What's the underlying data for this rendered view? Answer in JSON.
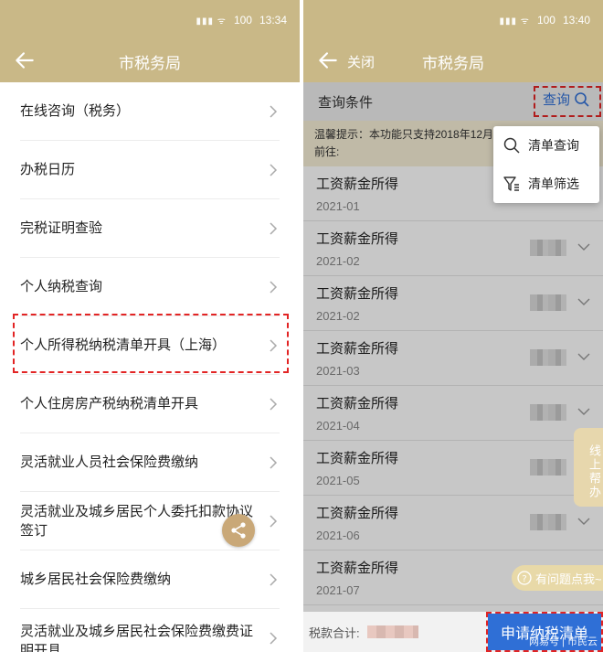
{
  "left": {
    "status": {
      "time": "13:34",
      "battery": "100"
    },
    "header": {
      "title": "市税务局"
    },
    "items": [
      {
        "label": "在线咨询（税务）"
      },
      {
        "label": "办税日历"
      },
      {
        "label": "完税证明查验"
      },
      {
        "label": "个人纳税查询"
      },
      {
        "label": "个人所得税纳税清单开具（上海）"
      },
      {
        "label": "个人住房房产税纳税清单开具"
      },
      {
        "label": "灵活就业人员社会保险费缴纳"
      },
      {
        "label": "灵活就业及城乡居民个人委托扣款协议签订"
      },
      {
        "label": "城乡居民社会保险费缴纳"
      },
      {
        "label": "灵活就业及城乡居民社会保险费缴费证明开具"
      }
    ]
  },
  "right": {
    "status": {
      "time": "13:40",
      "battery": "100"
    },
    "header": {
      "title": "市税务局",
      "close_label": "关闭"
    },
    "query": {
      "title": "查询条件",
      "button": "查询"
    },
    "tip": {
      "line1": "温馨提示：本功能只支持2018年12月",
      "line2": "前往:"
    },
    "dropdown": [
      {
        "label": "清单查询",
        "icon": "search-icon"
      },
      {
        "label": "清单筛选",
        "icon": "filter-icon"
      }
    ],
    "records": [
      {
        "name": "工资薪金所得",
        "date": "2021-01"
      },
      {
        "name": "工资薪金所得",
        "date": "2021-02"
      },
      {
        "name": "工资薪金所得",
        "date": "2021-02"
      },
      {
        "name": "工资薪金所得",
        "date": "2021-03"
      },
      {
        "name": "工资薪金所得",
        "date": "2021-04"
      },
      {
        "name": "工资薪金所得",
        "date": "2021-05"
      },
      {
        "name": "工资薪金所得",
        "date": "2021-06"
      },
      {
        "name": "工资薪金所得",
        "date": "2021-07"
      }
    ],
    "online_help": "线上帮办",
    "faq": "有问题点我~",
    "footer": {
      "total_label": "税款合计:",
      "apply_button": "申请纳税清单"
    },
    "watermark": "网易号 | 市民云"
  },
  "colors": {
    "header": "#c9b887",
    "primary": "#2f6fd6",
    "highlight": "#e22424"
  }
}
